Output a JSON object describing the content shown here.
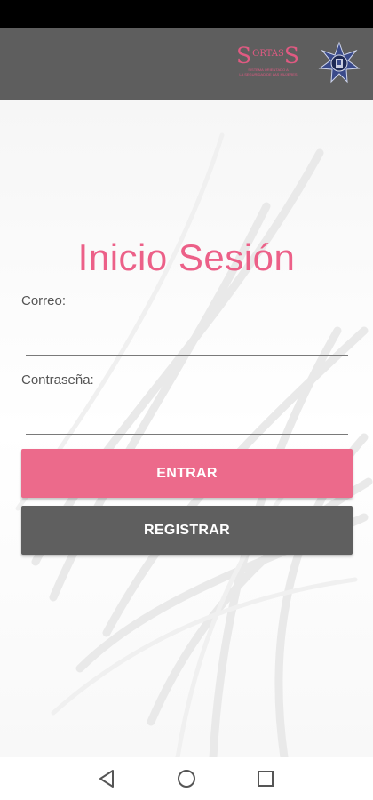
{
  "header": {
    "logo": {
      "wordmark_left": "S",
      "wordmark_mid": "ORTAS",
      "wordmark_right": "S",
      "tagline_line1": "SISTEMA ORIENTADO A",
      "tagline_line2": "LA SEGURIDAD DE LAS MUJERES"
    },
    "seal_icon": "police-seal-icon"
  },
  "main": {
    "title": "Inicio Sesión",
    "email_label": "Correo:",
    "email_value": "",
    "password_label": "Contraseña:",
    "password_value": "",
    "login_button": "ENTRAR",
    "register_button": "REGISTRAR"
  },
  "nav": {
    "back_icon": "back-triangle-icon",
    "home_icon": "home-circle-icon",
    "recents_icon": "recents-square-icon"
  },
  "colors": {
    "accent_pink": "#ec6a8b",
    "title_pink": "#ec6088",
    "header_gray": "#5e5e5e",
    "register_gray": "#5f5f5f"
  }
}
